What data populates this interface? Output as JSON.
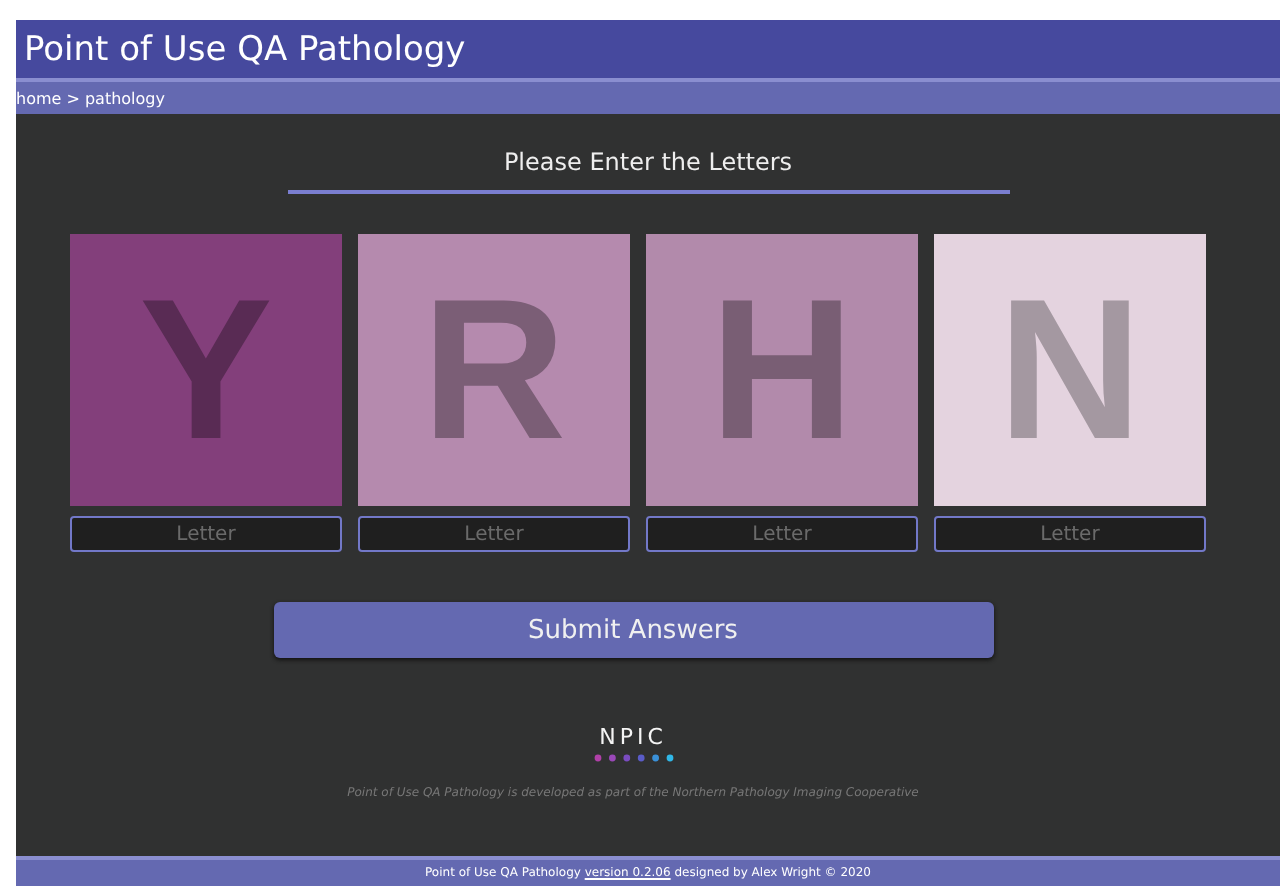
{
  "header": {
    "title": "Point of Use QA Pathology"
  },
  "breadcrumb": "home > pathology",
  "heading": "Please Enter the Letters",
  "tiles": [
    {
      "letter": "Y",
      "color": "#833f7b",
      "placeholder": "Letter"
    },
    {
      "letter": "R",
      "color": "#b58aae",
      "placeholder": "Letter"
    },
    {
      "letter": "H",
      "color": "#b28aab",
      "placeholder": "Letter"
    },
    {
      "letter": "N",
      "color": "#e4d3df",
      "placeholder": "Letter"
    }
  ],
  "submit_button": "Submit Answers",
  "logo": "NPIC",
  "credit": "Point of Use QA Pathology is developed as part of the Northern Pathology Imaging Cooperative",
  "footer": {
    "before": "Point of Use QA Pathology ",
    "link": "version 0.2.06",
    "after": " designed by Alex Wright © 2020"
  }
}
